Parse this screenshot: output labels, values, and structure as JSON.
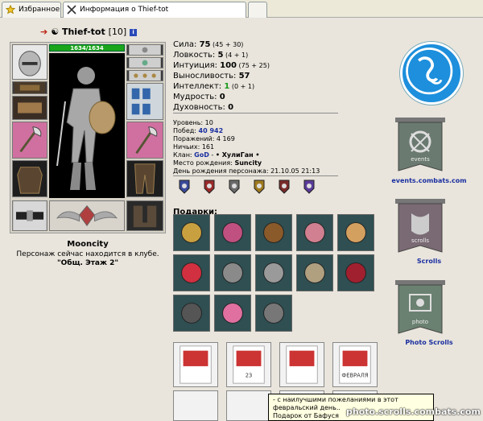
{
  "tabs": [
    {
      "label": "Избранное",
      "icon": "star-folder-icon"
    },
    {
      "label": "Информация о Thief-tot",
      "icon": "crossed-swords-icon"
    },
    {
      "label": "",
      "icon": "new-tab"
    }
  ],
  "character": {
    "nick": "Thief-tot",
    "level": "[10]",
    "info_icon": "i",
    "hp": "1634/1634",
    "city": "Mooncity",
    "location_line1": "Персонаж сейчас находится в клубе.",
    "location_line2": "\"Общ. Этаж 2\""
  },
  "stats": [
    {
      "name": "Сила:",
      "value": "75",
      "extra": "(45 + 30)"
    },
    {
      "name": "Ловкость:",
      "value": "5",
      "extra": "(4 + 1)"
    },
    {
      "name": "Интуиция:",
      "value": "100",
      "extra": "(75 + 25)"
    },
    {
      "name": "Выносливость:",
      "value": "57",
      "extra": ""
    },
    {
      "name": "Интеллект:",
      "value": "1",
      "extra": "(0 + 1)"
    },
    {
      "name": "Мудрость:",
      "value": "0",
      "extra": ""
    },
    {
      "name": "Духовность:",
      "value": "0",
      "extra": ""
    }
  ],
  "info": {
    "level": "Уровень: 10",
    "wins_label": "Побед:",
    "wins": "40 942",
    "losses": "Поражений: 4 169",
    "draws": "Ничьих: 161",
    "clan_label": "Клан:",
    "clan": "GoD",
    "clan_title": "• ХулиГан •",
    "birthplace_label": "Место рождения:",
    "birthplace": "Suncity",
    "birthday": "День рождения персонажа: 21.10.05 21:13"
  },
  "gifts_title": "Подарки:",
  "right": {
    "events_label": "events.combats.com",
    "scrolls_label": "Scrolls",
    "photo_label": "Photo Scrolls",
    "events_text": "events",
    "scrolls_text": "scrolls",
    "photo_text": "photo"
  },
  "tooltip": {
    "line1": "- с наилучшими пожеланиями в этот февральский день..",
    "line2": "Подарок от Бафуся"
  },
  "watermark": "photo.scrolls.combats.com",
  "cards_text": [
    "",
    "23",
    "",
    "ФЕВРАЛЯ"
  ],
  "colors": {
    "accent_blue": "#1a2fa0",
    "hp_green": "#1aa51a",
    "logo_blue": "#1d8fdc"
  }
}
